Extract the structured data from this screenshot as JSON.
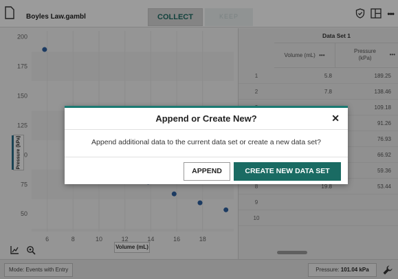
{
  "window": {
    "file_name": "Boyles Law.gambl"
  },
  "toolbar": {
    "collect_label": "COLLECT",
    "keep_label": "KEEP"
  },
  "graph": {
    "x_axis_label": "Volume (mL)",
    "y_axis_label": "Pressure (kPa)",
    "x_ticks": [
      6,
      8,
      10,
      12,
      14,
      16,
      18
    ],
    "y_ticks": [
      50,
      75,
      100,
      125,
      150,
      175,
      200
    ],
    "xlim": [
      4.8,
      20.4
    ],
    "ylim": [
      35,
      205
    ],
    "point_color": "#2e5f9e"
  },
  "chart_data": {
    "type": "scatter",
    "x": [
      5.8,
      7.8,
      9.8,
      11.8,
      13.8,
      15.8,
      17.8,
      19.8
    ],
    "y": [
      189.25,
      138.46,
      109.18,
      91.26,
      76.93,
      66.92,
      59.36,
      53.44
    ],
    "xlabel": "Volume (mL)",
    "ylabel": "Pressure (kPa)",
    "xlim": [
      4.8,
      20.4
    ],
    "ylim": [
      35,
      205
    ]
  },
  "table": {
    "data_set_title": "Data Set 1",
    "columns": [
      "Volume (mL)",
      "Pressure (kPa)"
    ],
    "menu_glyph": "•••",
    "row_numbers": [
      "1",
      "2",
      "3",
      "4",
      "5",
      "6",
      "7",
      "8",
      "9",
      "10"
    ],
    "rows": [
      {
        "volume": "5.8",
        "pressure": "189.25"
      },
      {
        "volume": "7.8",
        "pressure": "138.46"
      },
      {
        "volume": "",
        "pressure": "109.18"
      },
      {
        "volume": "",
        "pressure": "91.26"
      },
      {
        "volume": "",
        "pressure": "76.93"
      },
      {
        "volume": "",
        "pressure": "66.92"
      },
      {
        "volume": "17.8",
        "pressure": "59.36"
      },
      {
        "volume": "19.8",
        "pressure": "53.44"
      },
      {
        "volume": "",
        "pressure": ""
      },
      {
        "volume": "",
        "pressure": ""
      }
    ]
  },
  "status": {
    "mode_label": "Mode: Events with Entry",
    "pressure_prefix": "Pressure: ",
    "pressure_value": "101.04 kPa"
  },
  "dialog": {
    "title": "Append or Create New?",
    "close_glyph": "✕",
    "message": "Append additional data to the current data set or create a new data set?",
    "append_label": "APPEND",
    "create_label": "CREATE NEW DATA SET"
  },
  "colors": {
    "accent": "#1a6b63",
    "point": "#2e5f9e"
  }
}
